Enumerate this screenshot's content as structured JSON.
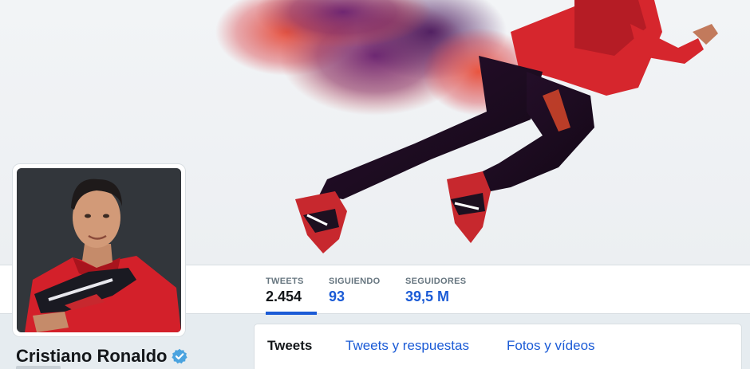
{
  "profile": {
    "name": "Cristiano Ronaldo",
    "verified": true
  },
  "stats": {
    "tweets": {
      "label": "TWEETS",
      "value": "2.454"
    },
    "following": {
      "label": "SIGUIENDO",
      "value": "93"
    },
    "followers": {
      "label": "SEGUIDORES",
      "value": "39,5 M"
    }
  },
  "tabs": {
    "tweets": "Tweets",
    "replies": "Tweets y respuestas",
    "media": "Fotos y vídeos"
  },
  "colors": {
    "accent": "#1b5bd6",
    "verified_badge": "#4aa3df",
    "page_background": "#e6ecf0"
  },
  "icons": {
    "verified": "verified-badge-icon"
  }
}
